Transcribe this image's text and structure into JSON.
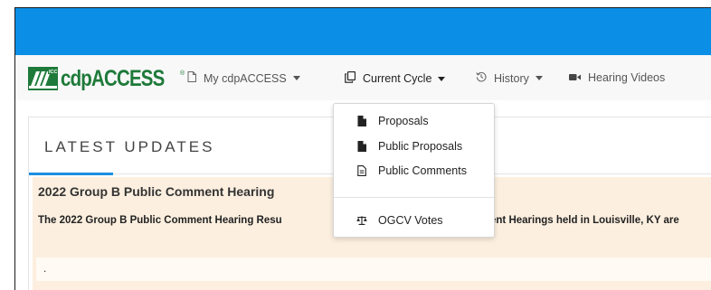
{
  "logo": {
    "text": "cdpACCESS",
    "mark_label": "ICC",
    "registered": "®"
  },
  "nav": {
    "my_cdpaccess": "My cdpACCESS",
    "current_cycle": "Current Cycle",
    "history": "History",
    "hearing_videos": "Hearing Videos"
  },
  "dropdown": {
    "proposals": "Proposals",
    "public_proposals": "Public Proposals",
    "public_comments": "Public Comments",
    "ogcv_votes": "OGCV Votes"
  },
  "panel": {
    "title": "LATEST UPDATES",
    "item_title": "2022 Group B Public Comment Hearing",
    "item_text_left": "The 2022 Group B Public Comment Hearing Resu",
    "item_text_right": "ent Hearings held in Louisville, KY are",
    "dot": "."
  },
  "colors": {
    "topbar": "#0b8fe6",
    "accent": "#1c8fe0",
    "logo_green": "#1e7a3a",
    "content_bg": "#fcefdf"
  }
}
